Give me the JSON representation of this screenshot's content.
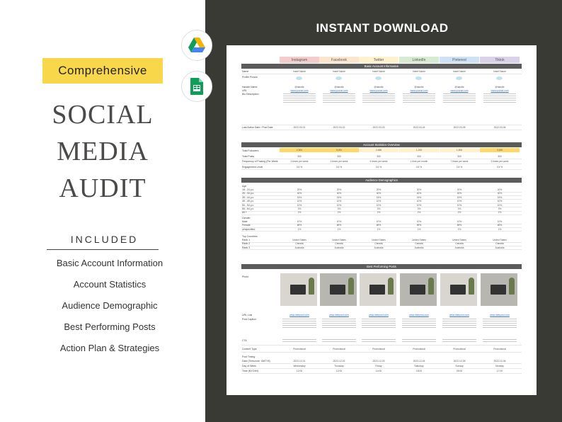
{
  "left": {
    "badge": "Comprehensive",
    "title_lines": [
      "SOCIAL",
      "MEDIA",
      "AUDIT"
    ],
    "included_heading": "INCLUDED",
    "included_items": [
      "Basic Account Information",
      "Account Statistics",
      "Audience Demographic",
      "Best Performing Posts",
      "Action Plan & Strategies"
    ]
  },
  "right": {
    "heading": "INSTANT DOWNLOAD",
    "icons": [
      "google-drive-icon",
      "google-sheets-icon"
    ]
  },
  "sheet": {
    "platforms": [
      {
        "name": "Instagram",
        "color": "#f4cccc"
      },
      {
        "name": "Facebook",
        "color": "#fce5cd"
      },
      {
        "name": "Twitter",
        "color": "#fff2cc"
      },
      {
        "name": "LinkedIn",
        "color": "#d9ead3"
      },
      {
        "name": "Pinterest",
        "color": "#cfe2f3"
      },
      {
        "name": "Tiktok",
        "color": "#d9d2e9"
      }
    ],
    "sections": {
      "basic": "Basic Account Information",
      "stats": "Account Statistics Overview",
      "demo": "Audience Demographics",
      "posts": "Best Performing Posts"
    },
    "basic_rows": [
      "Name",
      "Profile Picture",
      "Handle Name",
      "URL",
      "Bio Description",
      "Last Active Date / Post Date"
    ],
    "basic_values": {
      "name": "Insert Name",
      "handle": "@handle",
      "url": "www.yoururl.com",
      "dates": [
        "2022-03-01",
        "2022-03-02",
        "2022-03-03",
        "2022-03-04",
        "2022-03-05",
        "2022-03-06"
      ]
    },
    "stats_rows": [
      "Total Followers",
      "Total Posts",
      "Frequency of Posting (Per Week",
      "Engagement Level"
    ],
    "stats_values": {
      "followers": [
        "2,300",
        "3,000",
        "2,486",
        "1,243",
        "1,500",
        "3,300"
      ],
      "posts": [
        "300",
        "300",
        "300",
        "300",
        "300",
        "300"
      ],
      "frequency": [
        "3 times per week",
        "3 times per week",
        "5 times per week",
        "1 time per month",
        "7 times per week",
        "3 times per week"
      ],
      "engagement": [
        "3.5 %",
        "3.5 %",
        "3.5 %",
        "3.5 %",
        "3.5 %",
        "3.5 %"
      ]
    },
    "demo_age_label": "Age",
    "demo_age_rows": [
      "18 - 24 y.o",
      "25 - 34 y.o",
      "35 - 44 y.o",
      "45 - 49 y.o",
      "50 - 54 y.o",
      "55 - 64 y.o",
      "65 +"
    ],
    "demo_age_values": [
      "20%",
      "40%",
      "15%",
      "10%",
      "10%",
      "3%",
      "2%"
    ],
    "demo_gender_label": "Gender",
    "demo_gender_rows": [
      "Male",
      "Female",
      "Unspecified"
    ],
    "demo_gender_values": [
      "10%",
      "89%",
      "1%"
    ],
    "demo_country_label": "Top Countries",
    "demo_country_rows": [
      "Rank 1",
      "Rank 2",
      "Rank 3"
    ],
    "demo_country_values": [
      "United States",
      "Canada",
      "Australia"
    ],
    "posts_rows": [
      "Photo",
      "URL Link",
      "Post Caption",
      "CTA",
      "Content Type"
    ],
    "posts_url": "www.dietrpost.com",
    "content_type": "Promotional",
    "timing_label": "Post Timing",
    "timing_rows": [
      "Date (Timezone: GMT+8)",
      "Day of Week",
      "Time (NY/24H)"
    ],
    "timing_dates": [
      "2022-12-01",
      "2022-12-02",
      "2022-12-03",
      "2022-12-04",
      "2022-12-05",
      "2022-12-06"
    ],
    "timing_days": [
      "Wednesday",
      "Thursday",
      "Friday",
      "Saturday",
      "Sunday",
      "Monday"
    ],
    "timing_times": [
      "12:00",
      "12:00",
      "14:00",
      "18:00",
      "09:00",
      "17:00"
    ]
  }
}
